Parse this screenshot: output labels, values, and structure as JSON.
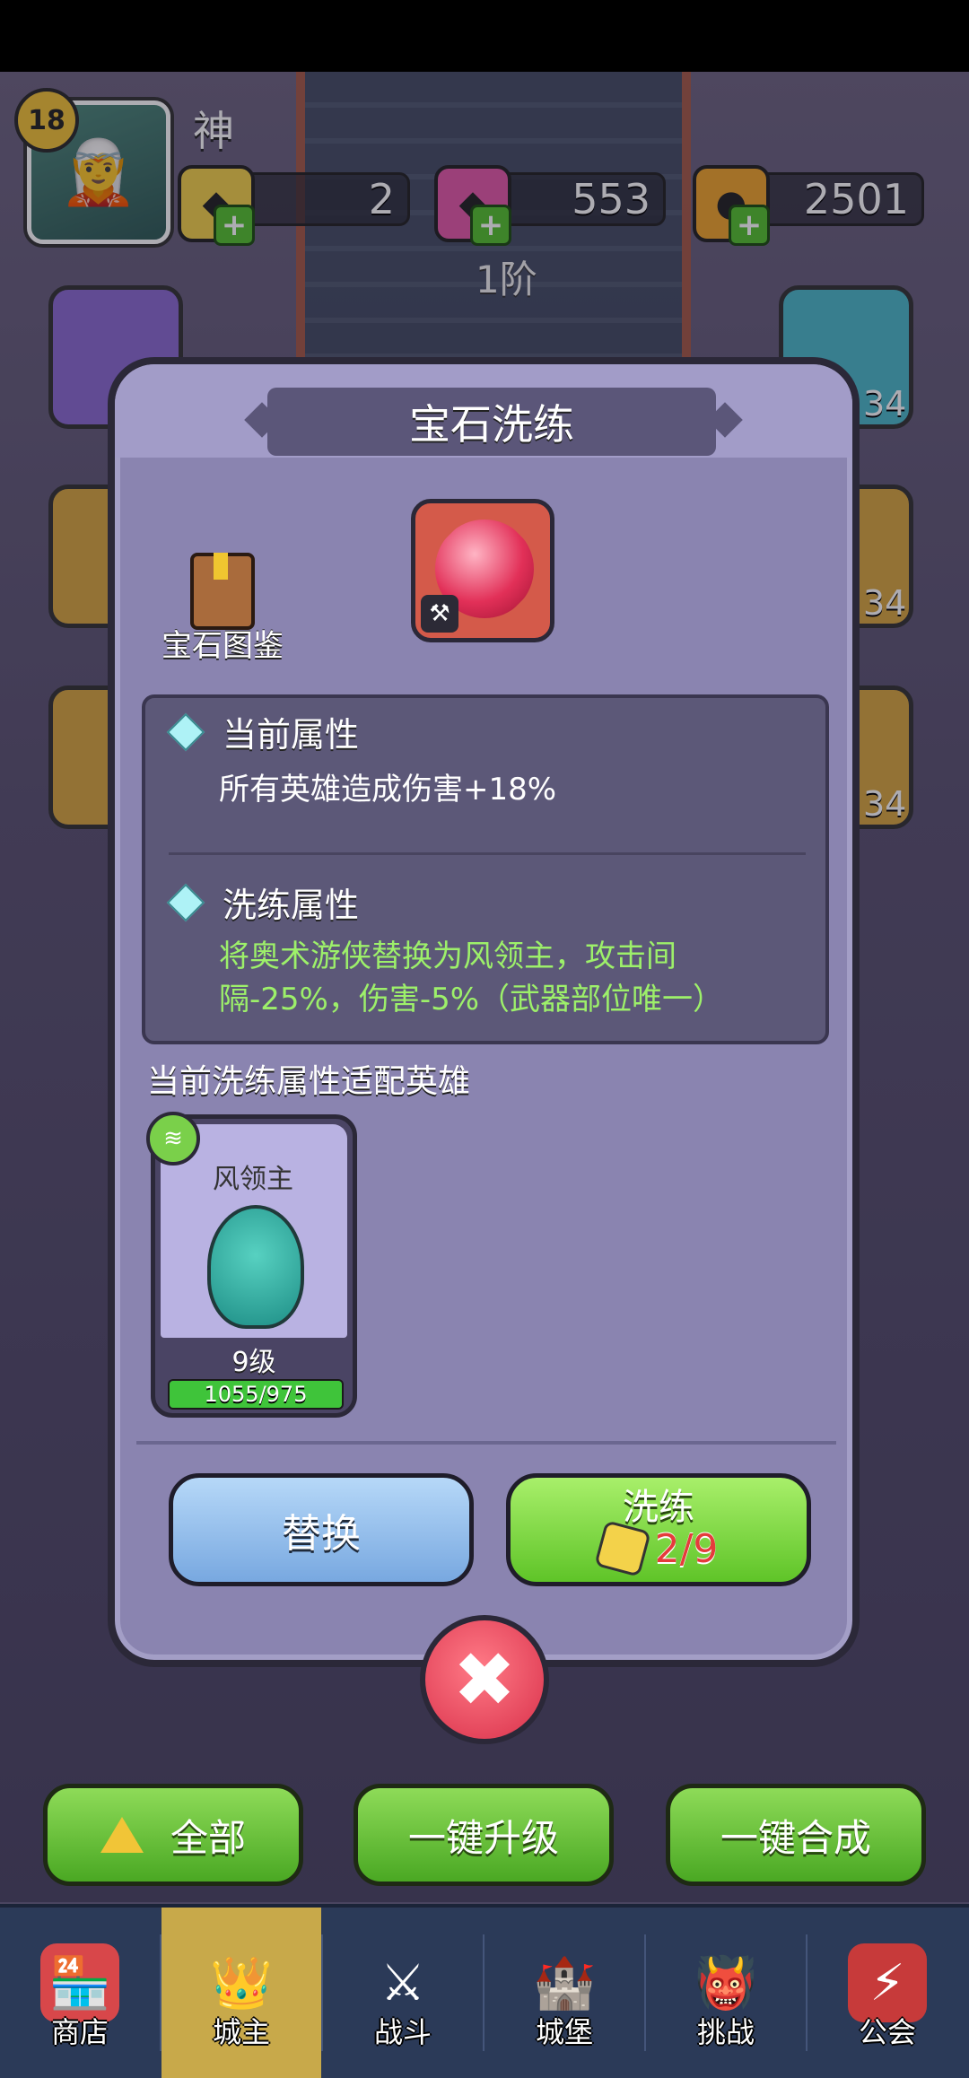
{
  "player": {
    "level": "18",
    "name": "神"
  },
  "currencies": [
    {
      "name": "gold-gem",
      "value": "2",
      "color": "#f3d24a"
    },
    {
      "name": "pink-crystal",
      "value": "553",
      "color": "#e45aa8"
    },
    {
      "name": "orange-coin",
      "value": "2501",
      "color": "#f0a52c"
    }
  ],
  "tier": "1阶",
  "side_counts": [
    "34",
    "34",
    "34"
  ],
  "modal": {
    "title": "宝石洗练",
    "codex_label": "宝石图鉴",
    "current": {
      "heading": "当前属性",
      "text": "所有英雄造成伤害+18%"
    },
    "refine": {
      "heading": "洗练属性",
      "text": "将奥术游侠替换为风领主，攻击间隔-25%，伤害-5%（武器部位唯一）"
    },
    "fit_label": "当前洗练属性适配英雄",
    "hero": {
      "name": "风领主",
      "level": "9级",
      "exp": "1055/975",
      "exp_fraction": 1.0
    },
    "replace_label": "替换",
    "refine_label": "洗练",
    "refine_cost": "2/9"
  },
  "actions": {
    "all_label": "全部",
    "upgrade_label": "一键升级",
    "merge_label": "一键合成"
  },
  "nav": [
    {
      "label": "商店",
      "icon": "shop-icon"
    },
    {
      "label": "城主",
      "icon": "crown-icon"
    },
    {
      "label": "战斗",
      "icon": "swords-icon"
    },
    {
      "label": "城堡",
      "icon": "castle-icon"
    },
    {
      "label": "挑战",
      "icon": "demon-icon"
    },
    {
      "label": "公会",
      "icon": "guild-banner-icon"
    }
  ],
  "colors": {
    "accent_green": "#5fc428",
    "accent_blue": "#78a8e0",
    "refine_text": "#9df06a",
    "cost_red": "#e53b3b",
    "modal_bg": "#8a84b0"
  }
}
